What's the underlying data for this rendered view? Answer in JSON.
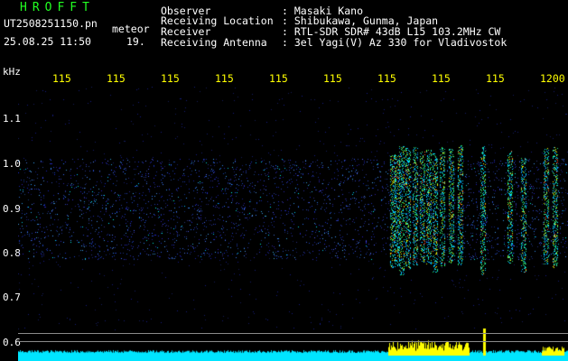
{
  "header": {
    "brand": "HROFFT",
    "filename": "UT2508251150.pn",
    "tag": "meteor",
    "datetime": "25.08.25 11:50",
    "minute": "19.",
    "fields": [
      {
        "label": "Observer",
        "value": ": Masaki Kano"
      },
      {
        "label": "Receiving Location",
        "value": ": Shibukawa, Gunma, Japan"
      },
      {
        "label": "Receiver",
        "value": ": RTL-SDR SDR# 43dB L15 103.2MHz CW"
      },
      {
        "label": "Receiving Antenna",
        "value": ": 3el Yagi(V) Az 330 for Vladivostok"
      }
    ]
  },
  "axis": {
    "unit": "kHz",
    "y_ticks": [
      "1.1",
      "1.0",
      "0.9",
      "0.8",
      "0.7",
      "0.6"
    ],
    "x_ticks": [
      "115",
      "115",
      "115",
      "115",
      "115",
      "115",
      "115",
      "115",
      "115",
      "1200"
    ]
  },
  "colors": {
    "text": "#ffffff",
    "brand": "#22ff22",
    "axis_labels": "#ffff00",
    "signal_bar": "#00e5ff",
    "signal_peak": "#ffff00",
    "noise": "#1a2aa8"
  }
}
